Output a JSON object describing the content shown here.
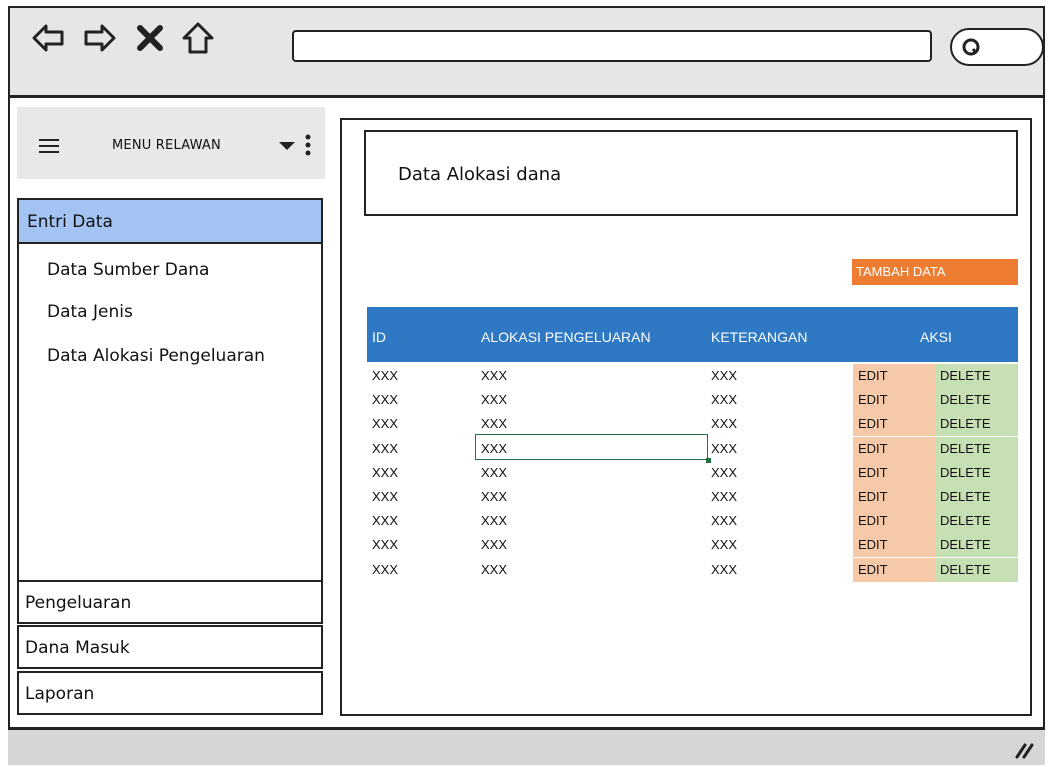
{
  "browser": {
    "icons": [
      "back-arrow-icon",
      "forward-arrow-icon",
      "close-x-icon",
      "home-icon",
      "search-icon",
      "resize-grip-icon"
    ]
  },
  "sidebar": {
    "menu_title": "MENU RELAWAN",
    "active_section": "Entri Data",
    "sub_items": [
      "Data Sumber Dana",
      "Data Jenis",
      "Data Alokasi Pengeluaran"
    ],
    "sections": [
      "Pengeluaran",
      "Dana Masuk",
      "Laporan"
    ]
  },
  "main": {
    "title": "Data Alokasi dana",
    "add_button": "TAMBAH DATA",
    "table": {
      "headers": [
        "ID",
        "ALOKASI PENGELUARAN",
        "KETERANGAN",
        "AKSI"
      ],
      "rows": [
        {
          "id": "XXX",
          "alokasi": "XXX",
          "keterangan": "XXX",
          "edit": "EDIT",
          "delete": "DELETE"
        },
        {
          "id": "XXX",
          "alokasi": "XXX",
          "keterangan": "XXX",
          "edit": "EDIT",
          "delete": "DELETE"
        },
        {
          "id": "XXX",
          "alokasi": "XXX",
          "keterangan": "XXX",
          "edit": "EDIT",
          "delete": "DELETE"
        },
        {
          "id": "XXX",
          "alokasi": "XXX",
          "keterangan": "XXX",
          "edit": "EDIT",
          "delete": "DELETE"
        },
        {
          "id": "XXX",
          "alokasi": "XXX",
          "keterangan": "XXX",
          "edit": "EDIT",
          "delete": "DELETE"
        },
        {
          "id": "XXX",
          "alokasi": "XXX",
          "keterangan": "XXX",
          "edit": "EDIT",
          "delete": "DELETE"
        },
        {
          "id": "XXX",
          "alokasi": "XXX",
          "keterangan": "XXX",
          "edit": "EDIT",
          "delete": "DELETE"
        },
        {
          "id": "XXX",
          "alokasi": "XXX",
          "keterangan": "XXX",
          "edit": "EDIT",
          "delete": "DELETE"
        },
        {
          "id": "XXX",
          "alokasi": "XXX",
          "keterangan": "XXX",
          "edit": "EDIT",
          "delete": "DELETE"
        }
      ]
    }
  },
  "colors": {
    "accent_blue": "#2e78c4",
    "active_menu": "#a3c4f3",
    "add_button": "#ee7d31",
    "edit_cell": "#f6c9a9",
    "delete_cell": "#c6e0b4"
  }
}
